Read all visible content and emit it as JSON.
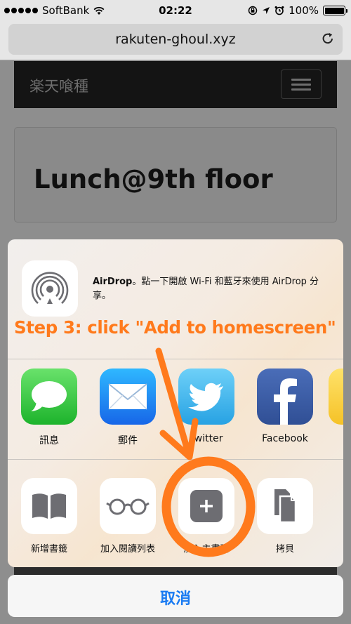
{
  "status_bar": {
    "carrier": "SoftBank",
    "time": "02:22",
    "battery": "100%",
    "battery_level": 1.0
  },
  "address_bar": {
    "url": "rakuten-ghoul.xyz"
  },
  "page": {
    "brand": "楽天喰種",
    "panel_title": "Lunch@9th floor"
  },
  "share_sheet": {
    "airdrop": {
      "title": "AirDrop",
      "description": "。點一下開啟 Wi-Fi 和藍牙來使用 AirDrop 分享。"
    },
    "apps": [
      {
        "label": "訊息",
        "icon": "messages-icon"
      },
      {
        "label": "郵件",
        "icon": "mail-icon"
      },
      {
        "label": "Twitter",
        "icon": "twitter-icon"
      },
      {
        "label": "Facebook",
        "icon": "facebook-icon"
      }
    ],
    "actions": [
      {
        "label": "新增書籤",
        "icon": "book-icon"
      },
      {
        "label": "加入閱讀列表",
        "icon": "glasses-icon"
      },
      {
        "label": "加入主畫面",
        "icon": "add-to-home-icon"
      },
      {
        "label": "拷貝",
        "icon": "copy-icon"
      }
    ],
    "cancel_label": "取消"
  },
  "annotation": {
    "text": "Step 3: click \"Add to homescreen\"",
    "color": "#ff7a1c"
  }
}
